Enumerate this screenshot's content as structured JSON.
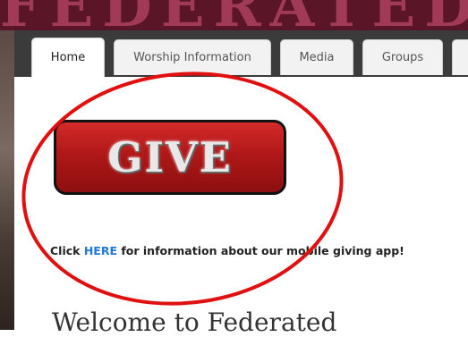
{
  "banner": {
    "text": "FEDERATED"
  },
  "nav": {
    "tabs": [
      {
        "label": "Home",
        "active": true
      },
      {
        "label": "Worship Information"
      },
      {
        "label": "Media"
      },
      {
        "label": "Groups"
      }
    ]
  },
  "content": {
    "give_button": {
      "label": "GIVE"
    },
    "info": {
      "prefix": "Click",
      "link": "HERE",
      "suffix": "for information about our mobile giving app!"
    },
    "welcome": "Welcome to Federated"
  },
  "colors": {
    "banner": "#5a1626",
    "nav_bar": "#3b3b3b",
    "give_button": "#b01818",
    "link": "#1f7ad6",
    "annotation_circle": "#e01010"
  }
}
